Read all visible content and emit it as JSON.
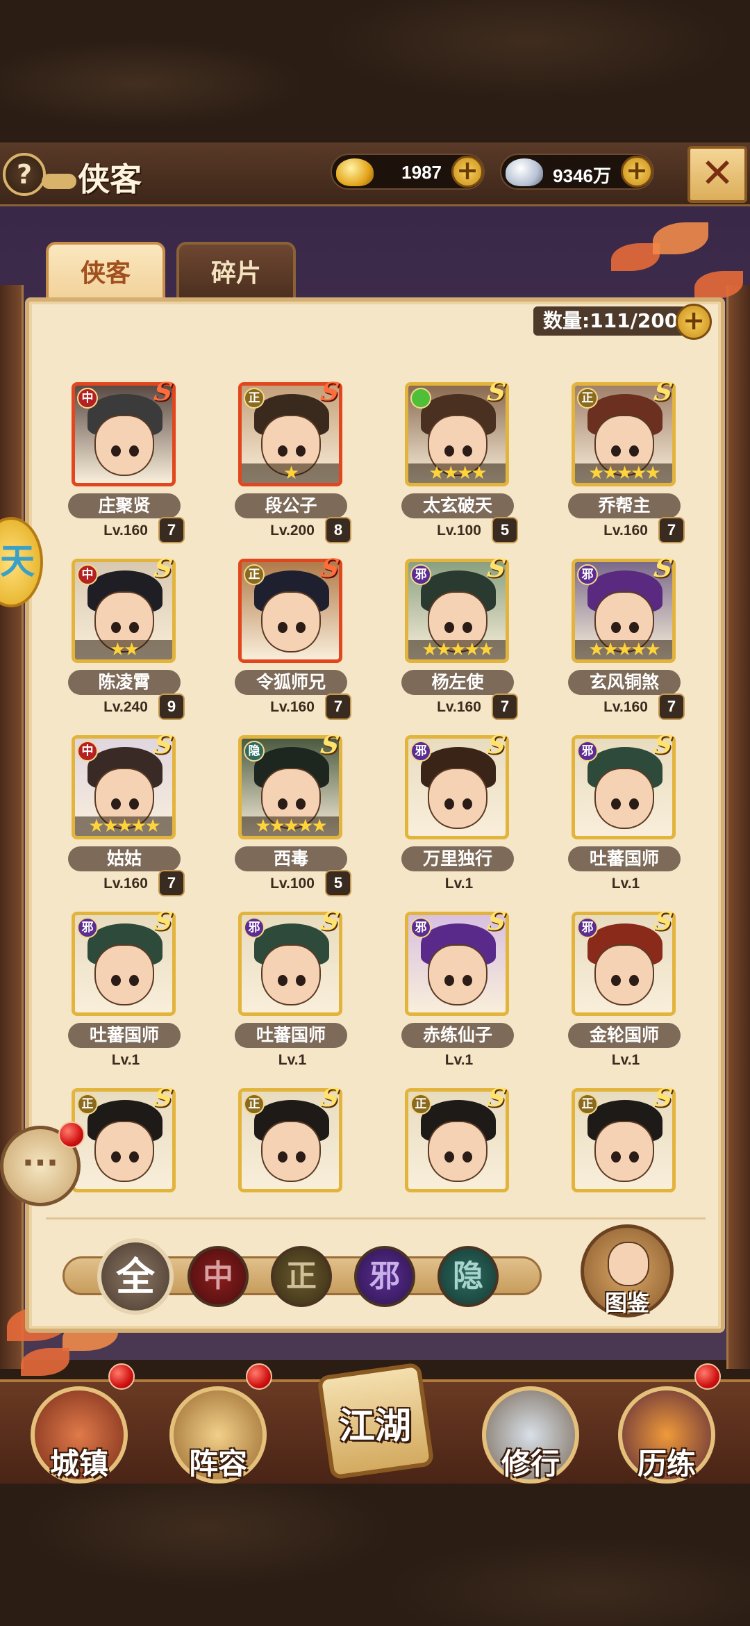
{
  "header": {
    "help_icon": "?",
    "title": "侠客",
    "gold": {
      "icon": "gold-ingot-icon",
      "value": "1987",
      "plus": "+"
    },
    "silver": {
      "icon": "silver-ingot-icon",
      "value": "9346万",
      "plus": "+"
    },
    "close_icon": "✕"
  },
  "tabs": [
    {
      "label": "侠客",
      "active": true
    },
    {
      "label": "碎片",
      "active": false
    }
  ],
  "capacity": {
    "label": "数量:111/200",
    "plus": "+"
  },
  "colors": {
    "faction_中": "#b52020",
    "faction_正": "#8a6a1e",
    "faction_邪": "#5b2d93",
    "faction_隐": "#2d6b60",
    "faction_green": "#4fbf3a",
    "accent_gold": "#e3b43c",
    "accent_red": "#e2461e"
  },
  "heroes": [
    {
      "name": "庄聚贤",
      "level": "Lv.160",
      "rank": "7",
      "faction": "中",
      "grade": "S",
      "stars": "",
      "red": true,
      "hair": "#3b3b3b",
      "bg": "#5a4a44"
    },
    {
      "name": "段公子",
      "level": "Lv.200",
      "rank": "8",
      "faction": "正",
      "grade": "S",
      "stars": "★",
      "red": true,
      "hair": "#3a2a1e",
      "bg": "#c4a07a"
    },
    {
      "name": "太玄破天",
      "level": "Lv.100",
      "rank": "5",
      "faction": "",
      "grade": "S",
      "stars": "★★★★",
      "red": false,
      "hair": "#4a3020",
      "bg": "#8a6a50"
    },
    {
      "name": "乔帮主",
      "level": "Lv.160",
      "rank": "7",
      "faction": "正",
      "grade": "S",
      "stars": "★★★★★",
      "red": false,
      "hair": "#6b3020",
      "bg": "#a0806a"
    },
    {
      "name": "陈凌霄",
      "level": "Lv.240",
      "rank": "9",
      "faction": "中",
      "grade": "S",
      "stars": "★★",
      "red": false,
      "hair": "#1e1e24",
      "bg": "#d8c8b0"
    },
    {
      "name": "令狐师兄",
      "level": "Lv.160",
      "rank": "7",
      "faction": "正",
      "grade": "S",
      "stars": "",
      "red": true,
      "hair": "#1e2030",
      "bg": "#b07a4a"
    },
    {
      "name": "杨左使",
      "level": "Lv.160",
      "rank": "7",
      "faction": "邪",
      "grade": "S",
      "stars": "★★★★★",
      "red": false,
      "hair": "#2a3a30",
      "bg": "#8aa080"
    },
    {
      "name": "玄风铜煞",
      "level": "Lv.160",
      "rank": "7",
      "faction": "邪",
      "grade": "S",
      "stars": "★★★★★",
      "red": false,
      "hair": "#5a2a80",
      "bg": "#7a6a8a"
    },
    {
      "name": "姑姑",
      "level": "Lv.160",
      "rank": "7",
      "faction": "中",
      "grade": "S",
      "stars": "★★★★★",
      "red": false,
      "hair": "#3a2a26",
      "bg": "#e0d6e0"
    },
    {
      "name": "西毒",
      "level": "Lv.100",
      "rank": "5",
      "faction": "隐",
      "grade": "S",
      "stars": "★★★★★",
      "red": false,
      "hair": "#1e2620",
      "bg": "#4a5a40"
    },
    {
      "name": "万里独行",
      "level": "Lv.1",
      "rank": "",
      "faction": "邪",
      "grade": "S",
      "stars": "",
      "red": false,
      "hair": "#3a2418",
      "bg": "#e8dcc0"
    },
    {
      "name": "吐蕃国师",
      "level": "Lv.1",
      "rank": "",
      "faction": "邪",
      "grade": "S",
      "stars": "",
      "red": false,
      "hair": "#2e4a3a",
      "bg": "#e8dcc0"
    },
    {
      "name": "吐蕃国师",
      "level": "Lv.1",
      "rank": "",
      "faction": "邪",
      "grade": "S",
      "stars": "",
      "red": false,
      "hair": "#2e4a3a",
      "bg": "#e8dcc0"
    },
    {
      "name": "吐蕃国师",
      "level": "Lv.1",
      "rank": "",
      "faction": "邪",
      "grade": "S",
      "stars": "",
      "red": false,
      "hair": "#2e4a3a",
      "bg": "#e8dcc0"
    },
    {
      "name": "赤练仙子",
      "level": "Lv.1",
      "rank": "",
      "faction": "邪",
      "grade": "S",
      "stars": "",
      "red": false,
      "hair": "#5a2a8a",
      "bg": "#d8c0e0"
    },
    {
      "name": "金轮国师",
      "level": "Lv.1",
      "rank": "",
      "faction": "邪",
      "grade": "S",
      "stars": "",
      "red": false,
      "hair": "#8a2a1a",
      "bg": "#e8dcc0"
    },
    {
      "name": "",
      "level": "",
      "rank": "",
      "faction": "正",
      "grade": "S",
      "stars": "",
      "red": false,
      "hair": "#1e1a18",
      "bg": "#e8dcc0"
    },
    {
      "name": "",
      "level": "",
      "rank": "",
      "faction": "正",
      "grade": "S",
      "stars": "",
      "red": false,
      "hair": "#1e1a18",
      "bg": "#e8dcc0"
    },
    {
      "name": "",
      "level": "",
      "rank": "",
      "faction": "正",
      "grade": "S",
      "stars": "",
      "red": false,
      "hair": "#1e1a18",
      "bg": "#e8dcc0"
    },
    {
      "name": "",
      "level": "",
      "rank": "",
      "faction": "正",
      "grade": "S",
      "stars": "",
      "red": false,
      "hair": "#1e1a18",
      "bg": "#e8dcc0"
    }
  ],
  "filters": {
    "all": "全",
    "zhong": "中",
    "zheng": "正",
    "xie": "邪",
    "yin": "隐"
  },
  "atlas": {
    "label": "图鉴"
  },
  "side": {
    "float_glyph": "天",
    "chat_icon": "···"
  },
  "nav": {
    "town": "城镇",
    "lineup": "阵容",
    "jianghu": "江湖",
    "cultivate": "修行",
    "train": "历练"
  }
}
